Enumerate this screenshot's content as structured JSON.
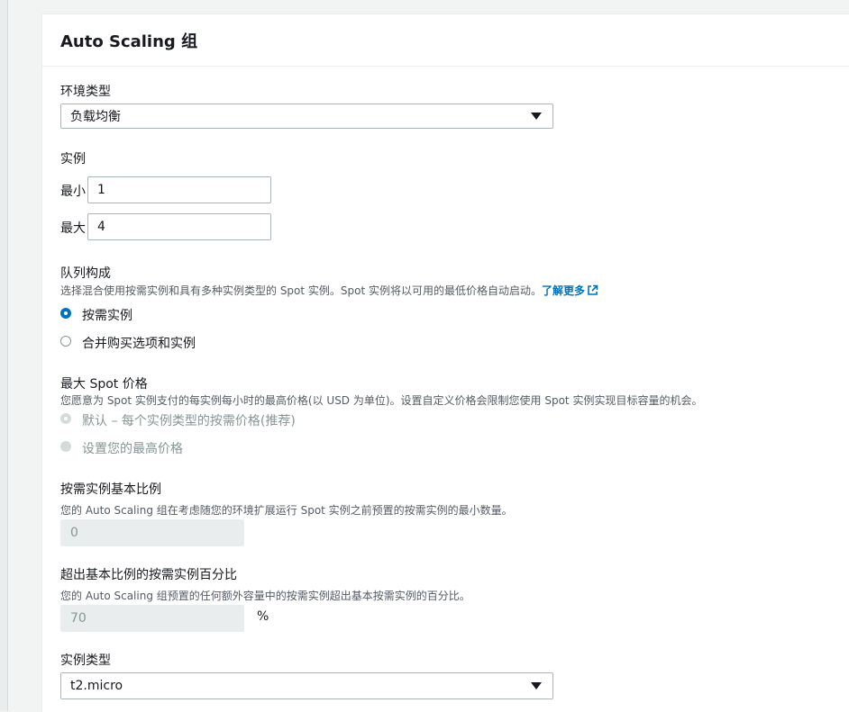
{
  "panel": {
    "title": "Auto Scaling 组"
  },
  "environment_type": {
    "label": "环境类型",
    "selected": "负载均衡"
  },
  "instances": {
    "label": "实例",
    "min_label": "最小",
    "min_value": "1",
    "max_label": "最大",
    "max_value": "4"
  },
  "fleet": {
    "label": "队列构成",
    "description": "选择混合使用按需实例和具有多种实例类型的 Spot 实例。Spot 实例将以可用的最低价格自动启动。",
    "learn_more": "了解更多",
    "options": [
      {
        "label": "按需实例",
        "checked": true
      },
      {
        "label": "合并购买选项和实例",
        "checked": false
      }
    ]
  },
  "max_spot_price": {
    "label": "最大 Spot 价格",
    "description": "您愿意为 Spot 实例支付的每实例每小时的最高价格(以 USD 为单位)。设置自定义价格会限制您使用 Spot 实例实现目标容量的机会。",
    "options": [
      {
        "label": "默认 – 每个实例类型的按需价格(推荐)",
        "checked": true
      },
      {
        "label": "设置您的最高价格",
        "checked": false
      }
    ]
  },
  "on_demand_base": {
    "label": "按需实例基本比例",
    "description": "您的 Auto Scaling 组在考虑随您的环境扩展运行 Spot 实例之前预置的按需实例的最小数量。",
    "value": "0"
  },
  "on_demand_percentage": {
    "label": "超出基本比例的按需实例百分比",
    "description": "您的 Auto Scaling 组预置的任何额外容量中的按需实例超出基本按需实例的百分比。",
    "value": "70",
    "unit": "%"
  },
  "instance_types": {
    "label": "实例类型",
    "selected": "t2.micro"
  },
  "colors": {
    "accent": "#0073bb",
    "disabled": "#d5dbdb",
    "border": "#aab7b8"
  }
}
